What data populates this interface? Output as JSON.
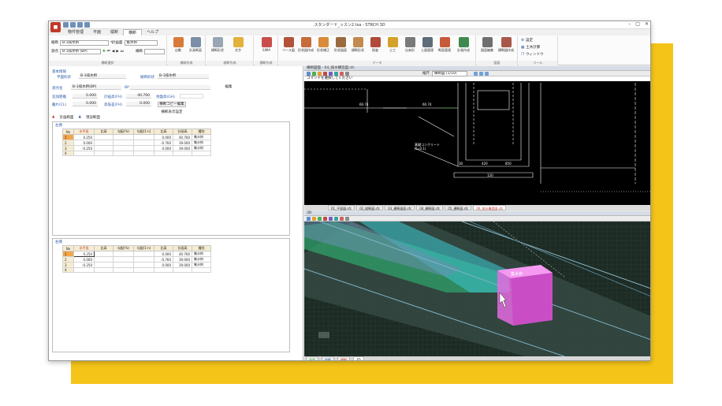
{
  "window": {
    "title": "スタンダード_ッスン2.tsa - STRCH 3D"
  },
  "menu_tabs": [
    "物件管理",
    "平面",
    "縦断",
    "横断",
    "ヘルプ"
  ],
  "ribbon": {
    "combo1_label": "縦断",
    "combo1_value": "B-1排水桝",
    "combo2_label": "測点",
    "combo2_value": "B-1排水桝 (BP)",
    "combo3_label": "計画面",
    "combo3_value": "集水桝",
    "combo4_label": "横断",
    "groups": [
      "横断選択",
      "補助作成",
      "縦断作成",
      "横断作成",
      "データ",
      "図面",
      "ツール"
    ],
    "buttons": [
      "自動",
      "計画断面",
      "横断形状",
      "文字",
      "SIMA",
      "ベース図",
      "形状図作成",
      "形状補正",
      "形状図面",
      "横断形状",
      "照査",
      "土工",
      "出来形",
      "土量管理",
      "断面管理",
      "計画作成",
      "図面編集",
      "横断図作成"
    ],
    "right_items": [
      "設定",
      "土木計算",
      "ウィンドウ"
    ]
  },
  "left": {
    "section_title": "基本情報",
    "f_plane_label": "平面形状",
    "f_plane_value": "B-1排水桝",
    "f_longi_label": "縦断形状",
    "f_longi_value": "B-1排水桝",
    "f_station_label": "測点名",
    "f_station_value": "B-1排水桝(BP)",
    "f_bp": "BP",
    "f_chain_label": "追加距離",
    "f_chain_value": "0.000",
    "f_plan_label": "計画高(FH)",
    "f_plan_value": "40.760",
    "f_ground_label": "地盤高(GH)",
    "f_ground_value": "0.000",
    "f_cl_label": "離れ(CL)",
    "f_cl_value": "0.000",
    "f_fh_label": "高低差(FH)",
    "f_fh_value": "0.000",
    "btn_edit": "編集",
    "btn_copy": "横断コピー編集",
    "btn_settings": "横断表示設定",
    "subtab1": "計画断面",
    "subtab2": "現況断面",
    "table_headers": [
      "No",
      "水平長",
      "比高",
      "勾配(%)",
      "勾配(1:n)",
      "比高",
      "計画高",
      "種別"
    ],
    "left_table_title": "左側",
    "left_rows": [
      [
        "1",
        "0.250",
        "",
        "",
        "",
        "0.000",
        "40.760",
        "集水桝"
      ],
      [
        "2",
        "0.000",
        "",
        "",
        "",
        "-0.760",
        "39.000",
        "集水桝"
      ],
      [
        "3",
        "-0.250",
        "",
        "",
        "",
        "0.000",
        "39.000",
        "集水桝"
      ],
      [
        "4",
        "",
        "",
        "",
        "",
        "",
        "",
        ""
      ]
    ],
    "right_table_title": "右側",
    "right_rows": [
      [
        "1",
        "0.250",
        "",
        "",
        "",
        "0.000",
        "40.760",
        "集水桝"
      ],
      [
        "2",
        "0.000",
        "",
        "",
        "",
        "-0.760",
        "39.000",
        "集水桝"
      ],
      [
        "3",
        "-0.250",
        "",
        "",
        "",
        "0.000",
        "39.000",
        "集水桝"
      ],
      [
        "4",
        "",
        "",
        "",
        "",
        "",
        "",
        ""
      ]
    ]
  },
  "right": {
    "cad_title": "横断図面 - 04_排水構造図.sfc",
    "cmd_prompt": "コマンドを選択してください",
    "scale_label": "縮尺",
    "scale_value": "横断図 (1/10)",
    "cad_dims": [
      "60.74",
      "60.74",
      "30",
      "420",
      "850",
      "120",
      "600",
      "120"
    ],
    "cad_annot_1": "基礎コンクリート",
    "cad_annot_2": "(t=0.1)",
    "doc_tabs": [
      "01_平面図.sfc",
      "02_縦断図.sfc",
      "03_横断図面.sfc",
      "04_横断図.sfc",
      "05_横断図.sfc",
      "06_排水構造図.sfc"
    ],
    "view3d_title": "3D",
    "view3d_label": "集水桝",
    "status_tabs": [
      "平面",
      "縦断",
      "横断",
      "3D"
    ]
  },
  "colors": {
    "accent": "#2a5aa8",
    "brand": "#c0392b",
    "background": "#f4c518"
  }
}
